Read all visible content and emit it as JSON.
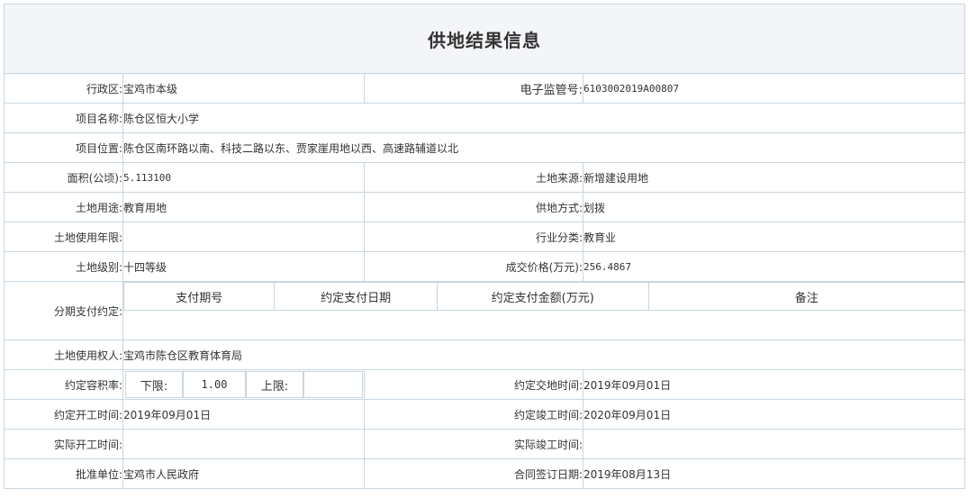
{
  "title": "供地结果信息",
  "rows": {
    "district_label": "行政区:",
    "district_value": "宝鸡市本级",
    "supervision_label": "电子监管号:",
    "supervision_value": "6103002019A00807",
    "project_name_label": "项目名称:",
    "project_name_value": "陈仓区恒大小学",
    "project_location_label": "项目位置:",
    "project_location_value": "陈仓区南环路以南、科技二路以东、贾家崖用地以西、高速路辅道以北",
    "area_label": "面积(公顷):",
    "area_value": "5.113100",
    "land_source_label": "土地来源:",
    "land_source_value": "新增建设用地",
    "land_use_label": "土地用途:",
    "land_use_value": "教育用地",
    "supply_method_label": "供地方式:",
    "supply_method_value": "划拨",
    "use_term_label": "土地使用年限:",
    "use_term_value": "",
    "industry_label": "行业分类:",
    "industry_value": "教育业",
    "land_grade_label": "土地级别:",
    "land_grade_value": "十四等级",
    "price_label": "成交价格(万元):",
    "price_value": "256.4867",
    "installment_label": "分期支付约定:",
    "installment_headers": [
      "支付期号",
      "约定支付日期",
      "约定支付金额(万元)",
      "备注"
    ],
    "user_label": "土地使用权人:",
    "user_value": "宝鸡市陈仓区教育体育局",
    "far_label": "约定容积率:",
    "far_lower_label": "下限:",
    "far_lower_value": "1.00",
    "far_upper_label": "上限:",
    "far_upper_value": "",
    "delivery_label": "约定交地时间:",
    "delivery_value": "2019年09月01日",
    "start_label": "约定开工时间:",
    "start_value": "2019年09月01日",
    "completion_label": "约定竣工时间:",
    "completion_value": "2020年09月01日",
    "actual_start_label": "实际开工时间:",
    "actual_start_value": "",
    "actual_completion_label": "实际竣工时间:",
    "actual_completion_value": "",
    "approver_label": "批准单位:",
    "approver_value": "宝鸡市人民政府",
    "contract_date_label": "合同签订日期:",
    "contract_date_value": "2019年08月13日"
  }
}
